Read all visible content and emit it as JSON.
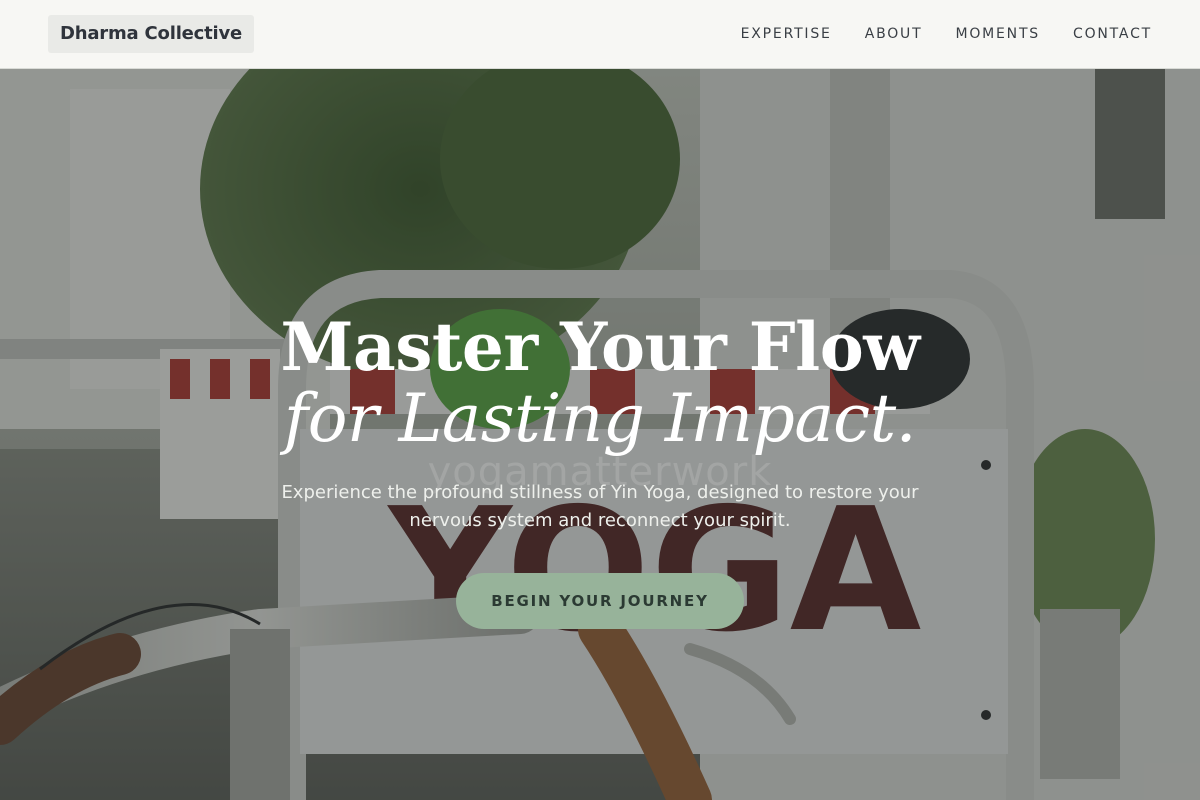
{
  "header": {
    "brand": "Dharma Collective",
    "nav": [
      "EXPERTISE",
      "ABOUT",
      "MOMENTS",
      "CONTACT"
    ]
  },
  "hero": {
    "headline_line1": "Master Your Flow",
    "headline_line2": "for Lasting Impact.",
    "background_watermark": "yogamatterwork",
    "sign_text": "YOGA",
    "subtext": "Experience the profound stillness of Yin Yoga, designed to restore your nervous system and reconnect your spirit.",
    "cta_label": "BEGIN YOUR JOURNEY"
  },
  "colors": {
    "header_bg": "#f7f7f4",
    "cta_bg": "#97b39a",
    "cta_text": "#2b3a33",
    "headline": "#ffffff"
  }
}
